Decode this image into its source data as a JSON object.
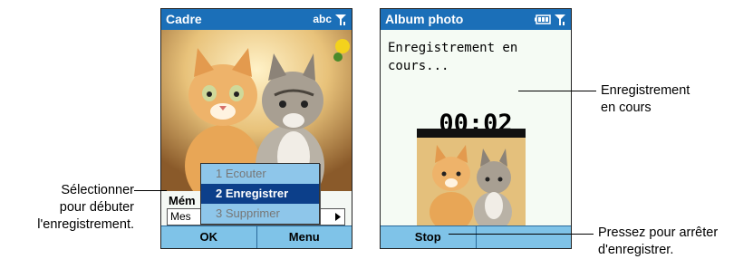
{
  "left_screen": {
    "title": "Cadre",
    "indicator": "abc",
    "memo_label": "Mém",
    "field_value": "Mes",
    "menu_items": [
      "1 Ecouter",
      "2 Enregistrer",
      "3 Supprimer"
    ],
    "softkeys": [
      "OK",
      "Menu"
    ]
  },
  "right_screen": {
    "title": "Album photo",
    "recording_text": "Enregistrement en cours...",
    "timer": "00:02",
    "softkeys": [
      "Stop",
      ""
    ]
  },
  "annotations": {
    "select_line1": "Sélectionner",
    "select_line2": "pour débuter",
    "select_line3": "l'enregistrement.",
    "recording_line1": "Enregistrement",
    "recording_line2": "en cours",
    "stop_line1": "Pressez pour arrêter",
    "stop_line2": "d'enregistrer."
  },
  "colors": {
    "titlebar": "#1b6fb8",
    "softbar": "#7fc3e8",
    "menu_selected": "#0c3f8a"
  }
}
